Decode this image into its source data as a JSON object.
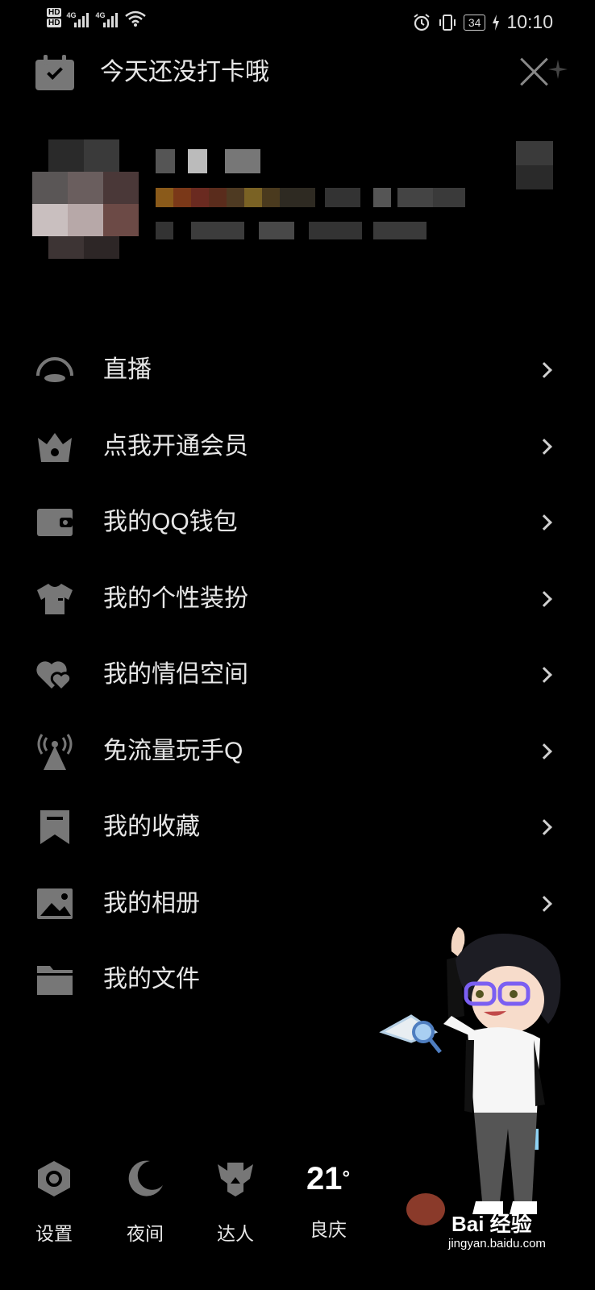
{
  "status_bar": {
    "hd1": "HD",
    "hd2": "HD",
    "net1": "4G",
    "net2": "4G",
    "battery": "34",
    "time": "10:10",
    "icons": [
      "alarm-icon",
      "vibrate-icon",
      "charging-icon",
      "wifi-icon"
    ]
  },
  "header": {
    "checkin_text": "今天还没打卡哦"
  },
  "menu": {
    "items": [
      {
        "label": "直播",
        "icon": "live-icon",
        "chevron": true
      },
      {
        "label": "点我开通会员",
        "icon": "vip-crown-icon",
        "chevron": true
      },
      {
        "label": "我的QQ钱包",
        "icon": "wallet-icon",
        "chevron": true
      },
      {
        "label": "我的个性装扮",
        "icon": "shirt-icon",
        "chevron": true
      },
      {
        "label": "我的情侣空间",
        "icon": "hearts-icon",
        "chevron": true
      },
      {
        "label": "免流量玩手Q",
        "icon": "signal-tower-icon",
        "chevron": true
      },
      {
        "label": "我的收藏",
        "icon": "bookmark-icon",
        "chevron": true
      },
      {
        "label": "我的相册",
        "icon": "photo-icon",
        "chevron": true
      },
      {
        "label": "我的文件",
        "icon": "folder-icon",
        "chevron": false
      }
    ]
  },
  "bottom_bar": {
    "settings": "设置",
    "night": "夜间",
    "expert": "达人",
    "temperature": "21",
    "degree": "°",
    "city": "良庆"
  },
  "watermark": {
    "brand": "Bai 经验",
    "url": "jingyan.baidu.com"
  },
  "colors": {
    "background": "#000000",
    "icon": "#777777",
    "text": "#e6e6e6"
  }
}
